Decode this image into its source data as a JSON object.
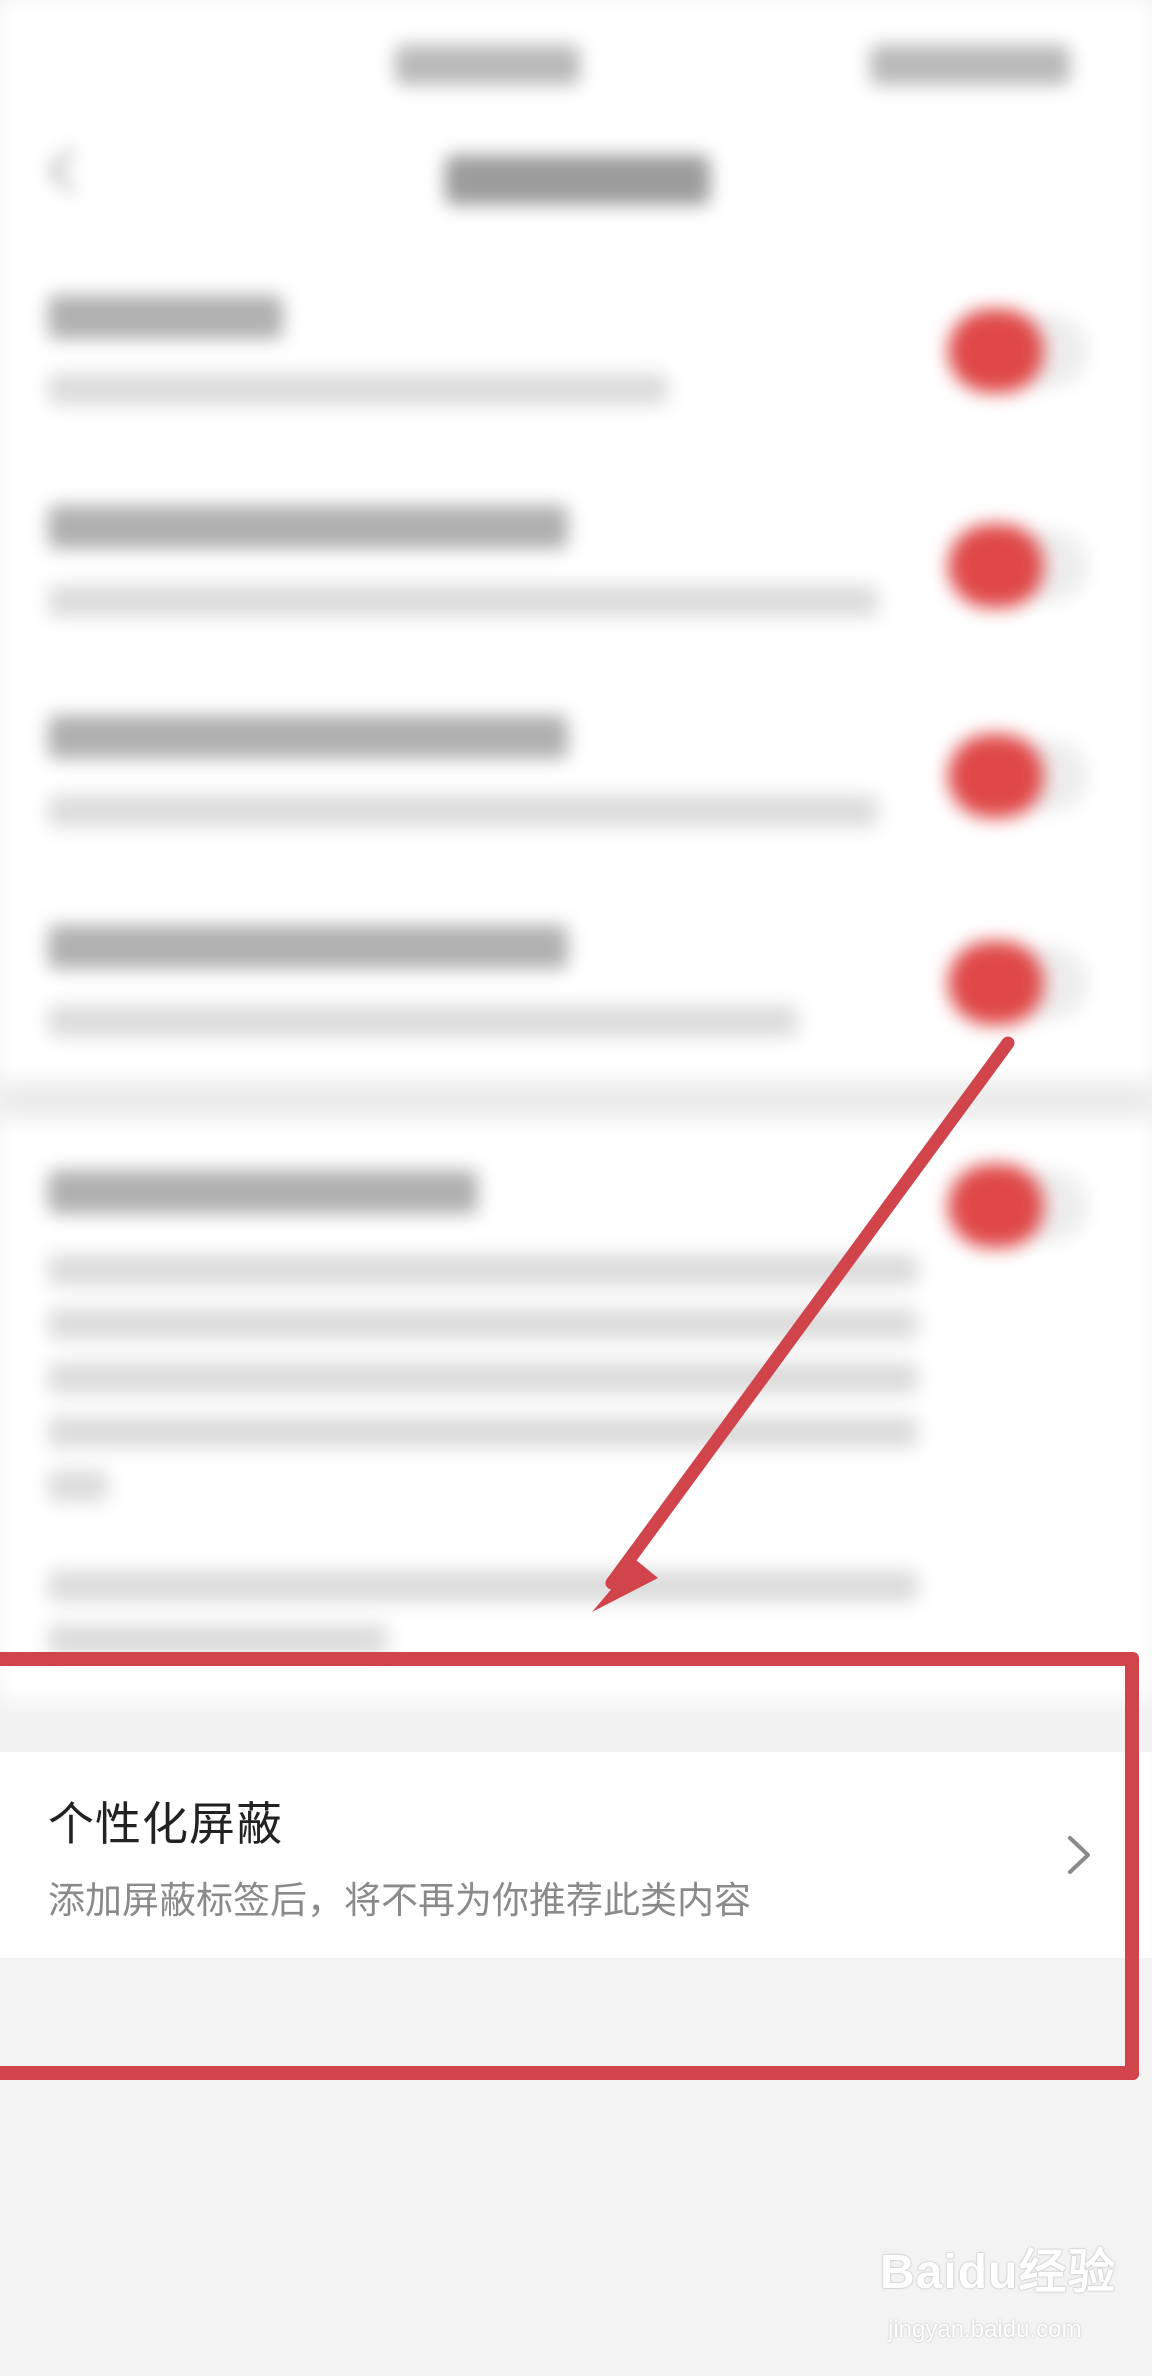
{
  "setting": {
    "title": "个性化屏蔽",
    "subtitle": "添加屏蔽标签后，将不再为你推荐此类内容"
  },
  "icons": {
    "chevron": "chevron-right-icon",
    "back": "back-arrow-icon",
    "toggle": "toggle-switch-icon"
  },
  "colors": {
    "annotation": "#d1444b",
    "toggle_on": "#e04848",
    "row_background": "#ffffff",
    "page_background": "#f3f3f3"
  },
  "watermark": {
    "logo": "Baidu经验",
    "site": "jingyan.baidu.com"
  }
}
